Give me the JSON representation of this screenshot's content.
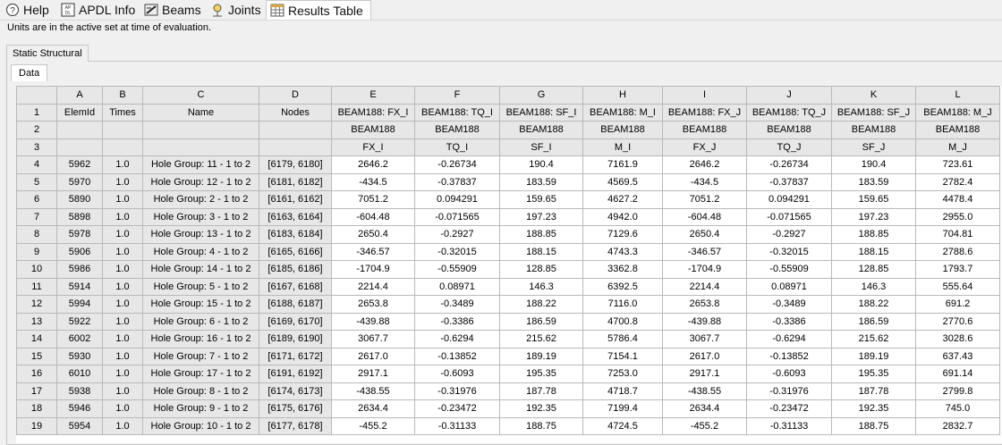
{
  "tabs": [
    {
      "label": "Help",
      "icon": "help-icon"
    },
    {
      "label": "APDL Info",
      "icon": "apdl-icon"
    },
    {
      "label": "Beams",
      "icon": "beams-icon"
    },
    {
      "label": "Joints",
      "icon": "joints-icon"
    },
    {
      "label": "Results Table",
      "icon": "table-icon"
    }
  ],
  "units_note": "Units are in the active set at time of evaluation.",
  "section_tab": "Static Structural",
  "data_tab": "Data",
  "table": {
    "col_letters": [
      "A",
      "B",
      "C",
      "D",
      "E",
      "F",
      "G",
      "H",
      "I",
      "J",
      "K",
      "L"
    ],
    "header_rows": [
      [
        "ElemId",
        "Times",
        "Name",
        "Nodes",
        "BEAM188: FX_I",
        "BEAM188: TQ_I",
        "BEAM188: SF_I",
        "BEAM188: M_I",
        "BEAM188: FX_J",
        "BEAM188: TQ_J",
        "BEAM188: SF_J",
        "BEAM188: M_J"
      ],
      [
        "",
        "",
        "",
        "",
        "BEAM188",
        "BEAM188",
        "BEAM188",
        "BEAM188",
        "BEAM188",
        "BEAM188",
        "BEAM188",
        "BEAM188"
      ],
      [
        "",
        "",
        "",
        "",
        "FX_I",
        "TQ_I",
        "SF_I",
        "M_I",
        "FX_J",
        "TQ_J",
        "SF_J",
        "M_J"
      ]
    ],
    "rows": [
      [
        "5962",
        "1.0",
        "Hole Group: 11 - 1 to 2",
        "[6179, 6180]",
        "2646.2",
        "-0.26734",
        "190.4",
        "7161.9",
        "2646.2",
        "-0.26734",
        "190.4",
        "723.61"
      ],
      [
        "5970",
        "1.0",
        "Hole Group: 12 - 1 to 2",
        "[6181, 6182]",
        "-434.5",
        "-0.37837",
        "183.59",
        "4569.5",
        "-434.5",
        "-0.37837",
        "183.59",
        "2782.4"
      ],
      [
        "5890",
        "1.0",
        "Hole Group: 2 - 1 to 2",
        "[6161, 6162]",
        "7051.2",
        "0.094291",
        "159.65",
        "4627.2",
        "7051.2",
        "0.094291",
        "159.65",
        "4478.4"
      ],
      [
        "5898",
        "1.0",
        "Hole Group: 3 - 1 to 2",
        "[6163, 6164]",
        "-604.48",
        "-0.071565",
        "197.23",
        "4942.0",
        "-604.48",
        "-0.071565",
        "197.23",
        "2955.0"
      ],
      [
        "5978",
        "1.0",
        "Hole Group: 13 - 1 to 2",
        "[6183, 6184]",
        "2650.4",
        "-0.2927",
        "188.85",
        "7129.6",
        "2650.4",
        "-0.2927",
        "188.85",
        "704.81"
      ],
      [
        "5906",
        "1.0",
        "Hole Group: 4 - 1 to 2",
        "[6165, 6166]",
        "-346.57",
        "-0.32015",
        "188.15",
        "4743.3",
        "-346.57",
        "-0.32015",
        "188.15",
        "2788.6"
      ],
      [
        "5986",
        "1.0",
        "Hole Group: 14 - 1 to 2",
        "[6185, 6186]",
        "-1704.9",
        "-0.55909",
        "128.85",
        "3362.8",
        "-1704.9",
        "-0.55909",
        "128.85",
        "1793.7"
      ],
      [
        "5914",
        "1.0",
        "Hole Group: 5 - 1 to 2",
        "[6167, 6168]",
        "2214.4",
        "0.08971",
        "146.3",
        "6392.5",
        "2214.4",
        "0.08971",
        "146.3",
        "555.64"
      ],
      [
        "5994",
        "1.0",
        "Hole Group: 15 - 1 to 2",
        "[6188, 6187]",
        "2653.8",
        "-0.3489",
        "188.22",
        "7116.0",
        "2653.8",
        "-0.3489",
        "188.22",
        "691.2"
      ],
      [
        "5922",
        "1.0",
        "Hole Group: 6 - 1 to 2",
        "[6169, 6170]",
        "-439.88",
        "-0.3386",
        "186.59",
        "4700.8",
        "-439.88",
        "-0.3386",
        "186.59",
        "2770.6"
      ],
      [
        "6002",
        "1.0",
        "Hole Group: 16 - 1 to 2",
        "[6189, 6190]",
        "3067.7",
        "-0.6294",
        "215.62",
        "5786.4",
        "3067.7",
        "-0.6294",
        "215.62",
        "3028.6"
      ],
      [
        "5930",
        "1.0",
        "Hole Group: 7 - 1 to 2",
        "[6171, 6172]",
        "2617.0",
        "-0.13852",
        "189.19",
        "7154.1",
        "2617.0",
        "-0.13852",
        "189.19",
        "637.43"
      ],
      [
        "6010",
        "1.0",
        "Hole Group: 17 - 1 to 2",
        "[6191, 6192]",
        "2917.1",
        "-0.6093",
        "195.35",
        "7253.0",
        "2917.1",
        "-0.6093",
        "195.35",
        "691.14"
      ],
      [
        "5938",
        "1.0",
        "Hole Group: 8 - 1 to 2",
        "[6174, 6173]",
        "-438.55",
        "-0.31976",
        "187.78",
        "4718.7",
        "-438.55",
        "-0.31976",
        "187.78",
        "2799.8"
      ],
      [
        "5946",
        "1.0",
        "Hole Group: 9 - 1 to 2",
        "[6175, 6176]",
        "2634.4",
        "-0.23472",
        "192.35",
        "7199.4",
        "2634.4",
        "-0.23472",
        "192.35",
        "745.0"
      ],
      [
        "5954",
        "1.0",
        "Hole Group: 10 - 1 to 2",
        "[6177, 6178]",
        "-455.2",
        "-0.31133",
        "188.75",
        "4724.5",
        "-455.2",
        "-0.31133",
        "188.75",
        "2832.7"
      ]
    ]
  }
}
